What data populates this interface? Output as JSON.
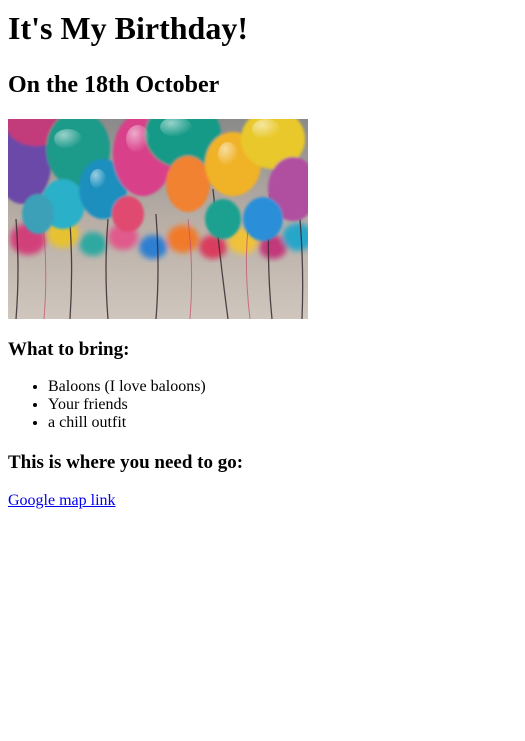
{
  "page": {
    "title": "It's My Birthday!",
    "subtitle": "On the 18th October",
    "image": {
      "description_icon": "balloons-photo"
    },
    "bring_heading": "What to bring:",
    "bring_items": [
      "Baloons (I love baloons)",
      "Your friends",
      "a chill outfit"
    ],
    "location_heading": "This is where you need to go:",
    "map_link_text": "Google map link"
  }
}
